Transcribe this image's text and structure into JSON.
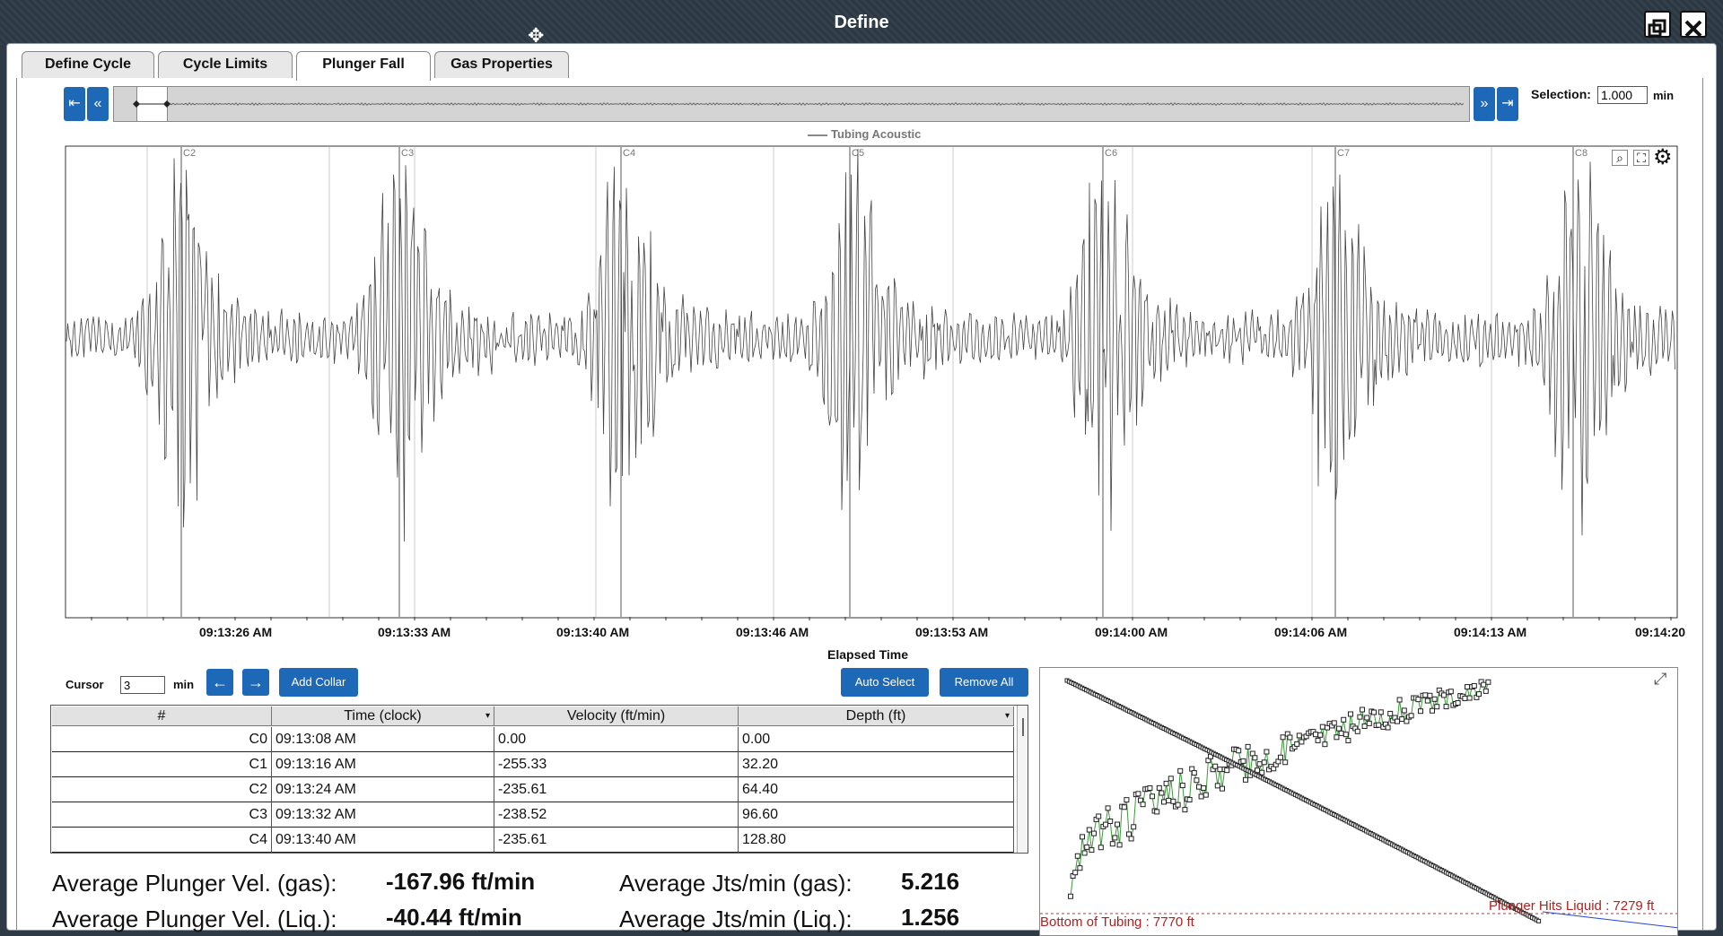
{
  "window": {
    "title": "Define",
    "restore_icon": "restore-window-icon",
    "close_icon": "close-icon"
  },
  "tabs": [
    {
      "label": "Define Cycle",
      "active": false
    },
    {
      "label": "Cycle Limits",
      "active": false
    },
    {
      "label": "Plunger Fall",
      "active": true
    },
    {
      "label": "Gas Properties",
      "active": false
    }
  ],
  "navigator": {
    "first_icon": "skip-first-icon",
    "prev_icon": "fast-back-icon",
    "next_icon": "fast-forward-icon",
    "last_icon": "skip-last-icon",
    "selection_label": "Selection:",
    "selection_value": "1.000",
    "selection_unit": "min"
  },
  "chart_data": {
    "type": "line",
    "series": [
      {
        "name": "Tubing Acoustic",
        "color": "#555555"
      }
    ],
    "legend_position": "top-center",
    "xlabel": "Elapsed Time",
    "x_ticks": [
      "09:13:26 AM",
      "09:13:33 AM",
      "09:13:40 AM",
      "09:13:46 AM",
      "09:13:53 AM",
      "09:14:00 AM",
      "09:14:06 AM",
      "09:14:13 AM",
      "09:14:20"
    ],
    "collar_markers": [
      "C2",
      "C3",
      "C4",
      "C5",
      "C6",
      "C7",
      "C8"
    ],
    "grid": true
  },
  "controls": {
    "cursor_label": "Cursor",
    "cursor_value": "3",
    "cursor_unit": "min",
    "prev_icon": "arrow-left-icon",
    "next_icon": "arrow-right-icon",
    "add_collar": "Add Collar",
    "auto_select": "Auto Select",
    "remove_all": "Remove All"
  },
  "table": {
    "headers": [
      "#",
      "Time (clock)",
      "Velocity (ft/min)",
      "Depth (ft)"
    ],
    "rows": [
      {
        "id": "C0",
        "time": "09:13:08 AM",
        "velocity": "0.00",
        "depth": "0.00"
      },
      {
        "id": "C1",
        "time": "09:13:16 AM",
        "velocity": "-255.33",
        "depth": "32.20"
      },
      {
        "id": "C2",
        "time": "09:13:24 AM",
        "velocity": "-235.61",
        "depth": "64.40"
      },
      {
        "id": "C3",
        "time": "09:13:32 AM",
        "velocity": "-238.52",
        "depth": "96.60"
      },
      {
        "id": "C4",
        "time": "09:13:40 AM",
        "velocity": "-235.61",
        "depth": "128.80"
      }
    ]
  },
  "stats": {
    "avg_vel_gas_label": "Average Plunger Vel. (gas):",
    "avg_vel_gas_value": "-167.96 ft/min",
    "avg_vel_liq_label": "Average Plunger Vel. (Liq.):",
    "avg_vel_liq_value": "-40.44 ft/min",
    "avg_jts_gas_label": "Average Jts/min (gas):",
    "avg_jts_gas_value": "5.216",
    "avg_jts_liq_label": "Average Jts/min (Liq.):",
    "avg_jts_liq_value": "1.256"
  },
  "depth_plot": {
    "liquid_label": "Plunger Hits Liquid : 7279 ft",
    "bottom_label": "Bottom of Tubing : 7770 ft",
    "expand_icon": "expand-icon",
    "colors": {
      "velocity": "#3a9a3a",
      "depth": "#222222",
      "marker": "#c03030",
      "blue": "#2244dd"
    }
  }
}
